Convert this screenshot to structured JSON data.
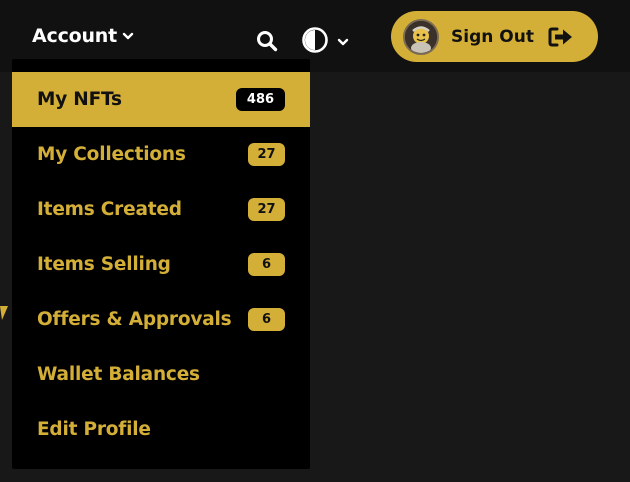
{
  "header": {
    "account_label": "Account",
    "signout_label": "Sign Out"
  },
  "icons": {
    "account_chevron": "chevron-down-icon",
    "search": "search-icon",
    "theme": "contrast-icon",
    "theme_chevron": "chevron-down-icon",
    "avatar": "avatar",
    "signout": "sign-out-icon"
  },
  "menu": {
    "items": [
      {
        "label": "My NFTs",
        "badge": "486",
        "active": true
      },
      {
        "label": "My Collections",
        "badge": "27"
      },
      {
        "label": "Items Created",
        "badge": "27"
      },
      {
        "label": "Items Selling",
        "badge": "6"
      },
      {
        "label": "Offers & Approvals",
        "badge": "6"
      },
      {
        "label": "Wallet Balances"
      },
      {
        "label": "Edit Profile"
      }
    ]
  },
  "colors": {
    "accent": "#d4af37",
    "background": "#141414",
    "menu_bg": "#000000",
    "header_text": "#ffffff"
  }
}
